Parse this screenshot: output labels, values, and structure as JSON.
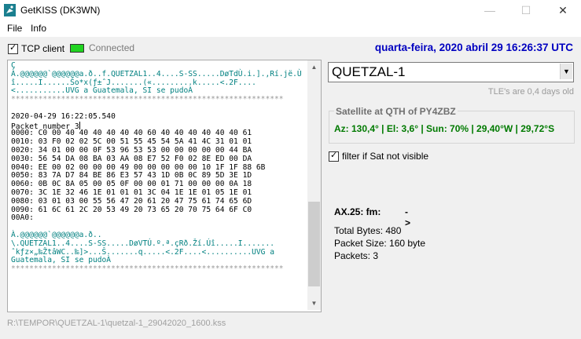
{
  "window": {
    "title": "GetKISS (DK3WN)",
    "icon": "satellite-dish-icon",
    "controls": {
      "minimize": "—",
      "maximize": "☐",
      "close": "✕"
    }
  },
  "menu": {
    "file": "File",
    "info": "Info"
  },
  "toolbar": {
    "tcp_label": "TCP client",
    "tcp_checked": true,
    "status_label": "Connected",
    "status_color": "#21d421",
    "datetime": "quarta-feira, 2020 abril 29  16:26:37 UTC"
  },
  "console": {
    "lines": [
      {
        "text": "Ç",
        "style": "teal"
      },
      {
        "text": "À.@@@@@@`@@@@@@a.ð..f.QUETZAL1..4....S-SS.....DøTdÙ.i.].,Rí.jë.Ù",
        "style": "teal"
      },
      {
        "text": "î.....I......Šo*x(ƒ±ˆJ.......(«.........k.....<.2F....",
        "style": "teal"
      },
      {
        "text": "<...........UVG a Guatemala, SI se pudoÀ",
        "style": "teal"
      },
      {
        "text": "************************************************************",
        "style": "gray"
      },
      {
        "text": "",
        "style": "black"
      },
      {
        "text": "2020-04-29 16:22:05.540",
        "style": "black"
      },
      {
        "text": "Packet number 3",
        "style": "black"
      },
      {
        "text": "0000: C0 00 40 40 40 40 40 40 60 40 40 40 40 40 40 61",
        "style": "black"
      },
      {
        "text": "0010: 03 F0 02 02 5C 00 51 55 45 54 5A 41 4C 31 01 01",
        "style": "black"
      },
      {
        "text": "0020: 34 01 00 00 0F 53 96 53 53 00 00 00 00 00 44 BA",
        "style": "black"
      },
      {
        "text": "0030: 56 54 DA 08 BA 03 AA 08 E7 52 F0 02 8E ED 00 DA",
        "style": "black"
      },
      {
        "text": "0040: EE 00 02 00 00 00 49 00 00 00 00 00 10 1F 1F 88 6B",
        "style": "black"
      },
      {
        "text": "0050: 83 7A D7 84 BE 86 E3 57 43 1D 0B 0C 89 5D 3E 1D",
        "style": "black"
      },
      {
        "text": "0060: 0B 0C 8A 05 00 05 0F 00 00 01 71 00 00 00 0A 18",
        "style": "black"
      },
      {
        "text": "0070: 3C 1E 32 46 1E 01 01 01 3C 04 1E 1E 01 05 1E 01",
        "style": "black"
      },
      {
        "text": "0080: 03 01 03 00 55 56 47 20 61 20 47 75 61 74 65 6D",
        "style": "black"
      },
      {
        "text": "0090: 61 6C 61 2C 20 53 49 20 73 65 20 70 75 64 6F C0",
        "style": "black"
      },
      {
        "text": "00A0:",
        "style": "black"
      },
      {
        "text": "",
        "style": "black"
      },
      {
        "text": "À.@@@@@@`@@@@@@a.ð..",
        "style": "teal"
      },
      {
        "text": "\\.QUETZAL1..4....S-SS.....DøVTÚ.º.ª.çRð.Ží.Úî.....I.......",
        "style": "teal"
      },
      {
        "text": "ˆkƒz×„‰ŽtâWC..‰]>...Š.......q.....<.2F....<..........UVG a",
        "style": "teal"
      },
      {
        "text": "Guatemala, SI se pudoÀ",
        "style": "teal"
      },
      {
        "text": "************************************************************",
        "style": "gray"
      }
    ]
  },
  "satellite": {
    "selected": "QUETZAL-1",
    "tle_age": "TLE's are 0,4 days old",
    "group_title": "Satellite at QTH of PY4ZBZ",
    "info": "Az: 130,4° | El: 3,6° | Sun: 70% | 29,40°W | 29,72°S",
    "filter_label": "filter if Sat not visible",
    "filter_checked": true
  },
  "packet": {
    "ax25_label": "AX.25:  fm:",
    "ax25_arrow": "->",
    "total_bytes": "Total Bytes: 480",
    "packet_size": "Packet Size: 160 byte",
    "packets": "Packets: 3"
  },
  "status": {
    "path": "R:\\TEMPOR\\QUETZAL-1\\quetzal-1_29042020_1600.kss"
  }
}
